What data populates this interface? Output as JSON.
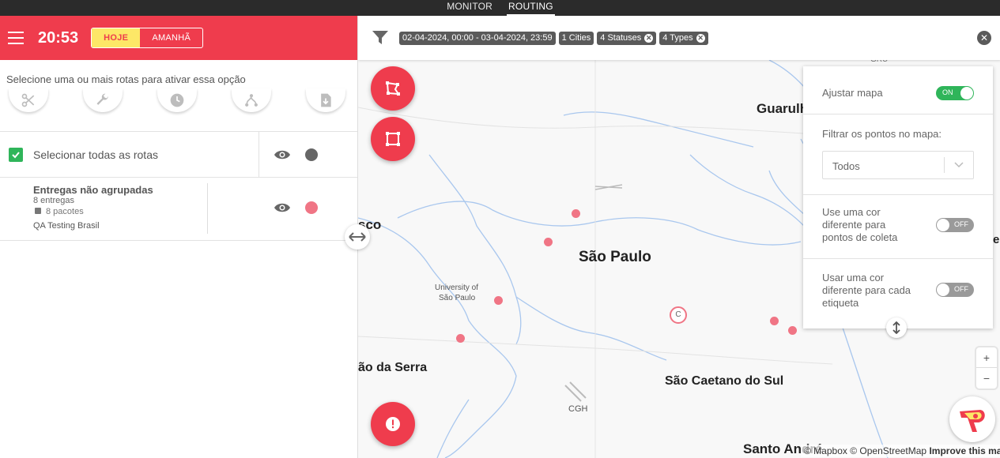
{
  "top_nav": {
    "tabs": [
      {
        "label": "MONITOR"
      },
      {
        "label": "ROUTING"
      }
    ]
  },
  "header": {
    "time": "20:53",
    "today_label": "HOJE",
    "tomorrow_label": "AMANHÃ"
  },
  "hint": "Selecione uma ou mais rotas para ativar essa opção",
  "tools": [
    {
      "icon": "scissors-icon"
    },
    {
      "icon": "wrench-icon"
    },
    {
      "icon": "clock-icon"
    },
    {
      "icon": "route-icon"
    },
    {
      "icon": "download-doc-icon"
    }
  ],
  "select_all": {
    "label": "Selecionar todas as rotas",
    "checked": true,
    "dot_color": "#666666"
  },
  "route": {
    "title": "Entregas não agrupadas",
    "deliveries": "8 entregas",
    "packages": "8 pacotes",
    "owner": "QA Testing Brasil",
    "dot_color": "#f07585"
  },
  "filters": {
    "date_range": "02-04-2024, 00:00 - 03-04-2024, 23:59",
    "cities": "1 Cities",
    "statuses": "4 Statuses",
    "types": "4 Types"
  },
  "map": {
    "labels": {
      "guarulhos": "Guarulh",
      "sao_paulo": "São Paulo",
      "osasco": "sco",
      "university": "University of",
      "university2": "São Paulo",
      "taboao": "ão da Serra",
      "sao_caetano": "São Caetano do Sul",
      "cgh": "CGH",
      "santo_andre": "Santo André",
      "gru": "GRU",
      "edge_right": "er",
      "cluster": "C"
    },
    "attribution_mapbox": "© Mapbox",
    "attribution_osm": "© OpenStreetMap",
    "attribution_improve": "Improve this map",
    "point_color": "#f07585"
  },
  "panel": {
    "adjust_label": "Ajustar mapa",
    "adjust_state": "ON",
    "filter_label": "Filtrar os pontos no mapa:",
    "filter_value": "Todos",
    "pickup_color_label": "Use uma cor diferente para pontos de coleta",
    "pickup_state": "OFF",
    "tag_color_label": "Usar uma cor diferente para cada etiqueta",
    "tag_state": "OFF"
  },
  "zoom": {
    "in": "+",
    "out": "−"
  },
  "colors": {
    "brand_red": "#ef3c4d",
    "today_yellow": "#fde767",
    "toggle_on": "#2fb55a",
    "toggle_off": "#9a9a9a"
  }
}
